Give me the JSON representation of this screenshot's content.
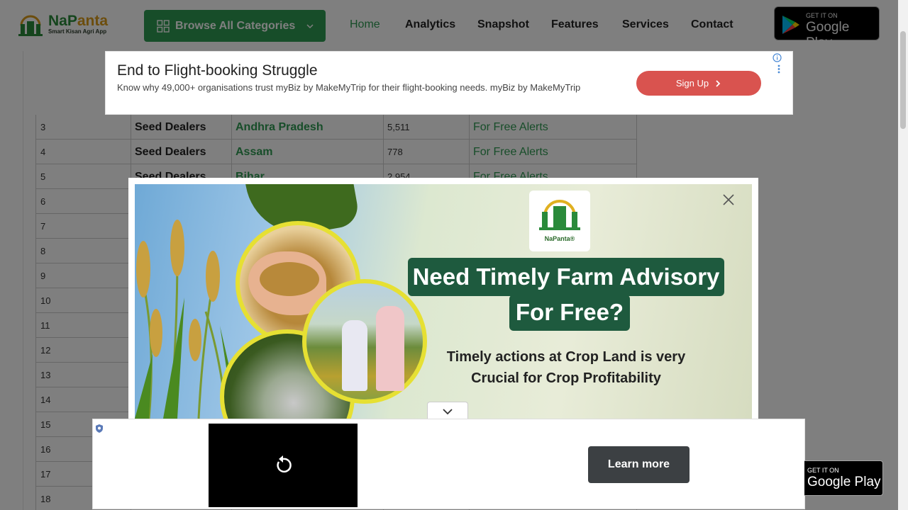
{
  "brand": {
    "name_part1": "NaP",
    "name_part2": "anta",
    "tagline": "Smart Kisan Agri App"
  },
  "header": {
    "browse_label": "Browse All Categories",
    "nav": [
      "Home",
      "Analytics",
      "Snapshot",
      "Features",
      "Services",
      "Contact"
    ],
    "active_nav": "Home",
    "store_small": "GET IT ON",
    "store_big": "Google Play"
  },
  "table": {
    "rows": [
      {
        "num": "3",
        "type": "Seed Dealers",
        "state": "Andhra Pradesh",
        "count": "5,511",
        "alert": "For Free Alerts"
      },
      {
        "num": "4",
        "type": "Seed Dealers",
        "state": "Assam",
        "count": "778",
        "alert": "For Free Alerts"
      },
      {
        "num": "5",
        "type": "Seed Dealers",
        "state": "Bihar",
        "count": "2,954",
        "alert": "For Free Alerts"
      },
      {
        "num": "6"
      },
      {
        "num": "7"
      },
      {
        "num": "8"
      },
      {
        "num": "9"
      },
      {
        "num": "10"
      },
      {
        "num": "11"
      },
      {
        "num": "12"
      },
      {
        "num": "13"
      },
      {
        "num": "14"
      },
      {
        "num": "15"
      },
      {
        "num": "16"
      },
      {
        "num": "17"
      },
      {
        "num": "18"
      }
    ]
  },
  "top_ad": {
    "title": "End to Flight-booking Struggle",
    "description": "Know why 49,000+ organisations trust myBiz by MakeMyTrip for their flight-booking needs. myBiz by MakeMyTrip",
    "cta": "Sign Up"
  },
  "popup": {
    "logo_text": "NaPanta®",
    "headline_line1": "Need Timely Farm Advisory",
    "headline_line2": "For Free?",
    "subtext": "Timely actions at Crop Land is very Crucial for Crop Profitability"
  },
  "bottom_ad": {
    "cta": "Learn more"
  },
  "bottom_store": {
    "small": "GET IT ON",
    "big": "Google Play"
  },
  "colors": {
    "brand_green": "#2e9a52",
    "dark_green": "#1e5a3e",
    "ad_red": "#d9534f",
    "accent_yellow": "#e6e033"
  },
  "icons": [
    "grid-icon",
    "chevron-down-icon",
    "play-triangle-icon",
    "info-icon",
    "more-vertical-icon",
    "chevron-right-icon",
    "close-icon",
    "replay-icon",
    "shield-icon"
  ]
}
